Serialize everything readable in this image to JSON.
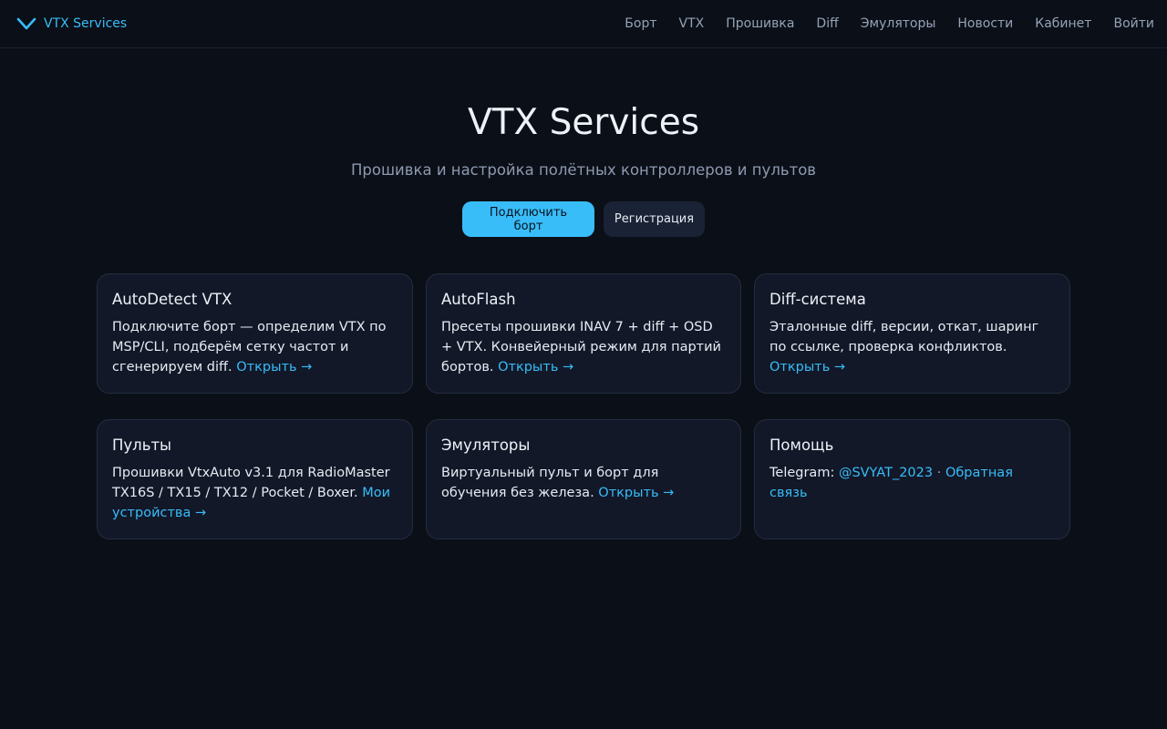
{
  "header": {
    "brand": "VTX Services",
    "brand_icon": "chevron-down-icon",
    "nav": [
      "Борт",
      "VTX",
      "Прошивка",
      "Diff",
      "Эмуляторы",
      "Новости",
      "Кабинет",
      "Войти"
    ]
  },
  "hero": {
    "title": "VTX Services",
    "subtitle": "Прошивка и настройка полётных контроллеров и пультов",
    "primary_button": "Подключить борт",
    "secondary_button": "Регистрация"
  },
  "cards": [
    {
      "title": "AutoDetect VTX",
      "text": "Подключите борт — определим VTX по MSP/CLI, подберём сетку частот и сгенерируем diff. ",
      "link": "Открыть →"
    },
    {
      "title": "AutoFlash",
      "text": "Пресеты прошивки INAV 7 + diff + OSD + VTX. Конвейерный режим для партий бортов. ",
      "link": "Открыть →"
    },
    {
      "title": "Diff-система",
      "text": "Эталонные diff, версии, откат, шаринг по ссылке, проверка конфликтов. ",
      "link": "Открыть →"
    },
    {
      "title": "Пульты",
      "text": "Прошивки VtxAuto v3.1 для RadioMaster TX16S / TX15 / TX12 / Pocket / Boxer. ",
      "link": "Мои устройства →"
    },
    {
      "title": "Эмуляторы",
      "text": "Виртуальный пульт и борт для обучения без железа. ",
      "link": "Открыть →"
    },
    {
      "title": "Помощь",
      "text": "Telegram: ",
      "link": "@SVYAT_2023",
      "separator": " · ",
      "link2": "Обратная связь"
    }
  ],
  "colors": {
    "background": "#0b0f17",
    "accent": "#38bdf8",
    "card_background": "#121828",
    "card_border": "#242d40",
    "muted_text": "#94a3b8"
  }
}
